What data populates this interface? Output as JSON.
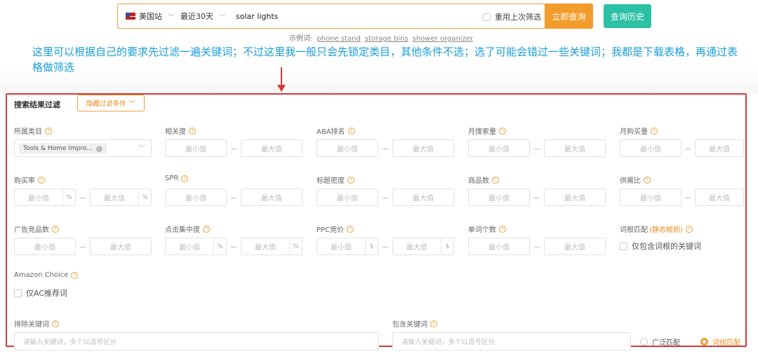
{
  "search": {
    "site": "美国站",
    "range": "最近30天",
    "query": "solar lights",
    "reuse_label": "重用上次筛选",
    "submit_label": "立即查询",
    "history_label": "查询历史",
    "examples_label": "示例词:",
    "examples": [
      "phone stand",
      "storage bins",
      "shower organizer"
    ]
  },
  "annotation": "这里可以根据自己的要求先过滤一遍关键词；不过这里我一般只会先锁定类目，其他条件不选；选了可能会错过一些关键词；我都是下载表格，再通过表格做筛选",
  "panel": {
    "title": "搜索结果过滤",
    "hide_label": "隐藏过滤条件",
    "min": "最小值",
    "max": "最大值",
    "category_label": "所属类目",
    "category_value": "Tools & Home Impro...",
    "relevance_label": "相关度",
    "aba_label": "ABA排名",
    "search_volume_label": "月搜索量",
    "purchase_volume_label": "月购买量",
    "purchase_rate_label": "购买率",
    "spr_label": "SPR",
    "title_density_label": "标题密度",
    "product_count_label": "商品数",
    "supply_demand_label": "供需比",
    "ad_products_label": "广告竞品数",
    "click_concentration_label": "点击集中度",
    "ppc_label": "PPC竞价",
    "word_count_label": "单词个数",
    "root_match_label": "词根匹配",
    "root_match_mode": "(静态规则)",
    "root_only_label": "仅包含词根的关键词",
    "amazon_choice_label": "Amazon Choice",
    "ac_only_label": "仅AC推荐词",
    "exclude_label": "排除关键词",
    "include_label": "包含关键词",
    "keyword_placeholder": "请输入关键词，多个以逗号区分",
    "broad_match_label": "广泛匹配",
    "phrase_match_label": "词组匹配",
    "units": {
      "percent": "%",
      "dollar": "$"
    }
  },
  "colors": {
    "accent": "#f39c2b",
    "teal": "#2cc1a4",
    "annotation": "#1a9ed8",
    "highlight_border": "#d43a3a"
  }
}
